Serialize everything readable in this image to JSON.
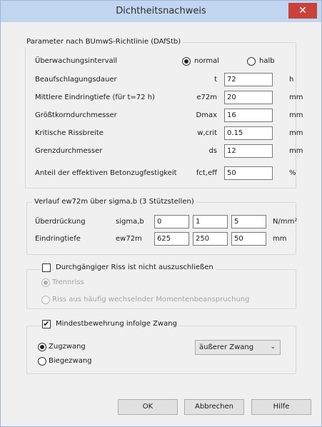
{
  "window": {
    "title": "Dichtheitsnachweis",
    "close_glyph": "✕"
  },
  "params": {
    "group_label": "Parameter nach BUmwS-Richtlinie (DAfStb)",
    "interval": {
      "label": "Überwachungsintervall",
      "opt_normal": "normal",
      "opt_halb": "halb",
      "selected": "normal"
    },
    "rows": [
      {
        "label": "Beaufschlagungsdauer",
        "symbol": "t",
        "value": "72",
        "unit": "h"
      },
      {
        "label": "Mittlere Eindringtiefe (für t=72 h)",
        "symbol": "e72m",
        "value": "20",
        "unit": "mm"
      },
      {
        "label": "Größtkorndurchmesser",
        "symbol": "Dmax",
        "value": "16",
        "unit": "mm"
      },
      {
        "label": "Kritische Rissbreite",
        "symbol": "w,crit",
        "value": "0.15",
        "unit": "mm"
      },
      {
        "label": "Grenzdurchmesser",
        "symbol": "ds",
        "value": "12",
        "unit": "mm"
      },
      {
        "label": "Anteil der effektiven Betonzugfestigkeit",
        "symbol": "fct,eff",
        "value": "50",
        "unit": "%"
      }
    ]
  },
  "verlauf": {
    "group_label": "Verlauf ew72m über sigma,b  (3 Stützstellen)",
    "rows": [
      {
        "label": "Überdrückung",
        "symbol": "sigma,b",
        "values": [
          "0",
          "1",
          "5"
        ],
        "unit": "N/mm²"
      },
      {
        "label": "Eindringtiefe",
        "symbol": "ew72m",
        "values": [
          "625",
          "250",
          "50"
        ],
        "unit": "mm"
      }
    ]
  },
  "riss": {
    "checkbox_label": "Durchgängiger Riss ist nicht auszuschließen",
    "checked": false,
    "opt1": "Trennriss",
    "opt2": "Riss aus häufig wechselnder Momentenbeanspruchung"
  },
  "mindest": {
    "checkbox_label": "Mindestbewehrung infolge Zwang",
    "checked": true,
    "check_glyph": "✔",
    "opt1": "Zugzwang",
    "opt2": "Biegezwang",
    "selected": "Zugzwang",
    "dropdown_value": "äußerer Zwang",
    "dropdown_arrow": "⌄"
  },
  "buttons": {
    "ok": "OK",
    "cancel": "Abbrechen",
    "help": "Hilfe"
  }
}
